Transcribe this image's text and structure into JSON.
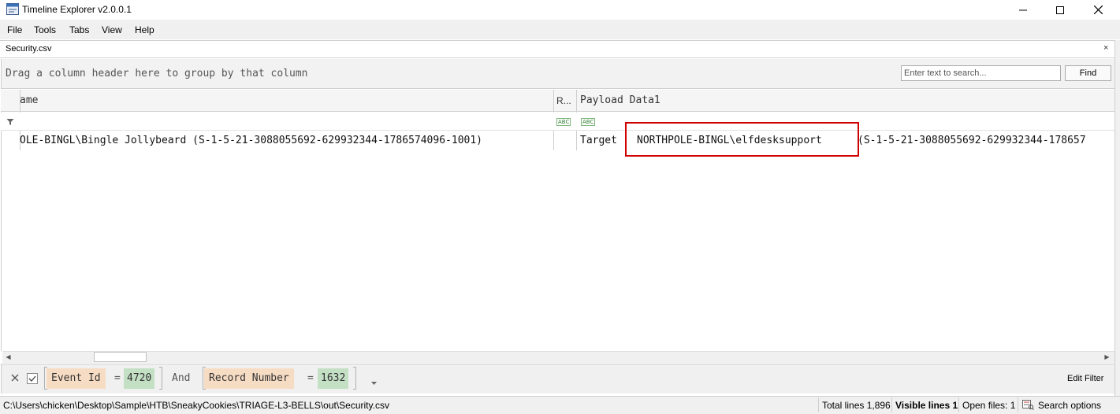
{
  "window": {
    "title": "Timeline Explorer v2.0.0.1"
  },
  "menu": [
    "File",
    "Tools",
    "Tabs",
    "View",
    "Help"
  ],
  "tab": {
    "title": "Security.csv",
    "close": "×"
  },
  "group_panel": {
    "hint": "Drag a column header here to group by that column"
  },
  "search": {
    "placeholder": "Enter text to search...",
    "find_label": "Find"
  },
  "grid": {
    "columns": [
      {
        "label": "ame"
      },
      {
        "label": "R..."
      },
      {
        "label": "Payload Data1"
      }
    ],
    "row": {
      "name_cell": "OLE-BINGL\\Bingle Jollybeard (S-1-5-21-3088055692-629932344-1786574096-1001)",
      "payload_prefix": "Target",
      "payload_account": "NORTHPOLE-BINGL\\elfdesksupport",
      "payload_sid": "(S-1-5-21-3088055692-629932344-178657"
    },
    "filter_icon_text": "ABC"
  },
  "filter_bar": {
    "criteria": [
      {
        "field": "Event Id",
        "operator": "=",
        "value": "4720"
      },
      {
        "field": "Record Number",
        "operator": "=",
        "value": "1632"
      }
    ],
    "join": "And",
    "edit_label": "Edit Filter"
  },
  "status": {
    "path": "C:\\Users\\chicken\\Desktop\\Sample\\HTB\\SneakyCookies\\TRIAGE-L3-BELLS\\out\\Security.csv",
    "total_lines": "Total lines 1,896",
    "visible_lines": "Visible lines 1",
    "open_files": "Open files: 1",
    "search_options": "Search options"
  },
  "colors": {
    "highlight_box": "#d00000",
    "field_chip": "#f7dcc4",
    "value_chip": "#c4e0c4"
  },
  "icons": [
    "app-icon",
    "minimize-icon",
    "maximize-icon",
    "close-icon",
    "filter-icon",
    "abc-filter-icon",
    "check-icon",
    "dropdown-arrow-icon",
    "search-options-icon",
    "scroll-left-icon",
    "scroll-right-icon"
  ]
}
